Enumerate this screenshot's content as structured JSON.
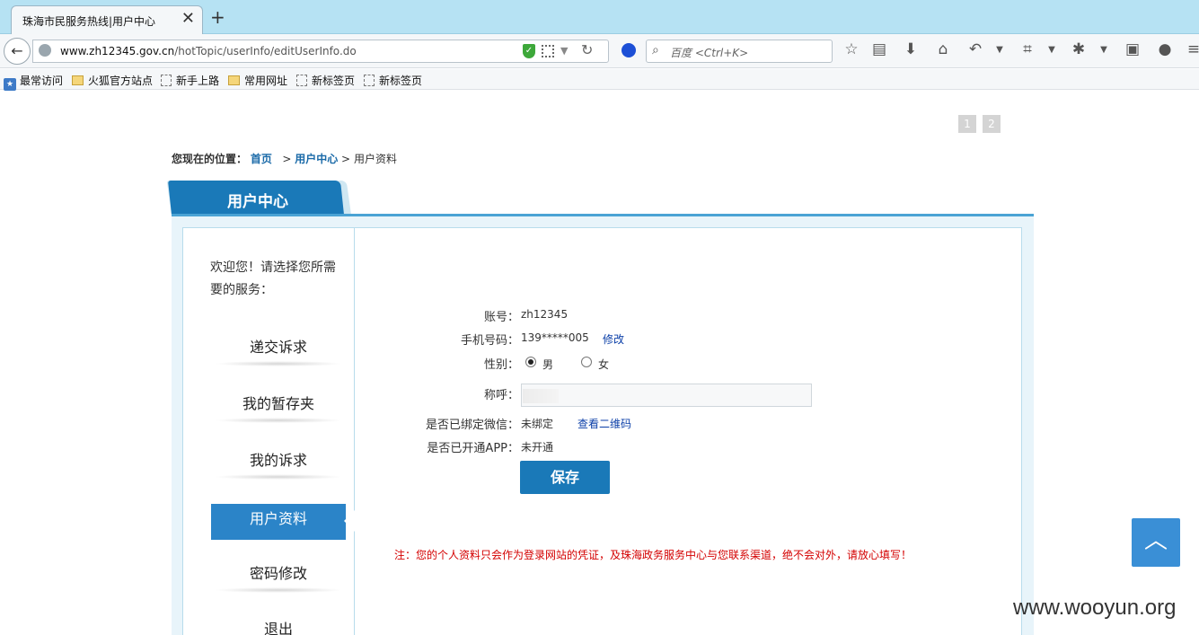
{
  "browser": {
    "tab_title": "珠海市民服务热线|用户中心",
    "tab_close": "✕",
    "new_tab": "+",
    "url_domain": "www.zh12345.gov.cn",
    "url_path": "/hotTopic/userInfo/editUserInfo.do",
    "search_placeholder": "百度 <Ctrl+K>"
  },
  "bookmarks": [
    {
      "label": "最常访问"
    },
    {
      "label": "火狐官方站点"
    },
    {
      "label": "新手上路"
    },
    {
      "label": "常用网址"
    },
    {
      "label": "新标签页"
    },
    {
      "label": "新标签页"
    }
  ],
  "pager": [
    "1",
    "2"
  ],
  "breadcrumb": {
    "prefix": "您现在的位置：",
    "home": "首页",
    "sep1": ">",
    "center": "用户中心",
    "sep2": ">",
    "current": "用户资料"
  },
  "section_title": "用户中心",
  "sidebar": {
    "welcome": "欢迎您！请选择您所需要的服务：",
    "items": [
      {
        "label": "递交诉求"
      },
      {
        "label": "我的暂存夹"
      },
      {
        "label": "我的诉求"
      },
      {
        "label": "用户资料"
      },
      {
        "label": "密码修改"
      },
      {
        "label": "退出"
      }
    ]
  },
  "form": {
    "account_label": "账号：",
    "account_value": "zh12345",
    "phone_label": "手机号码：",
    "phone_value": "139*****005",
    "phone_edit": "修改",
    "gender_label": "性别：",
    "gender_male": "男",
    "gender_female": "女",
    "gender_selected": "男",
    "nickname_label": "称呼：",
    "wechat_label": "是否已绑定微信：",
    "wechat_value": "未绑定",
    "wechat_link": "查看二维码",
    "app_label": "是否已开通APP：",
    "app_value": "未开通",
    "save": "保存"
  },
  "note": "注：您的个人资料只会作为登录网站的凭证，及珠海政务服务中心与您联系渠道，绝不会对外，请放心填写！",
  "back_to_top": "︿",
  "watermark": "www.wooyun.org"
}
